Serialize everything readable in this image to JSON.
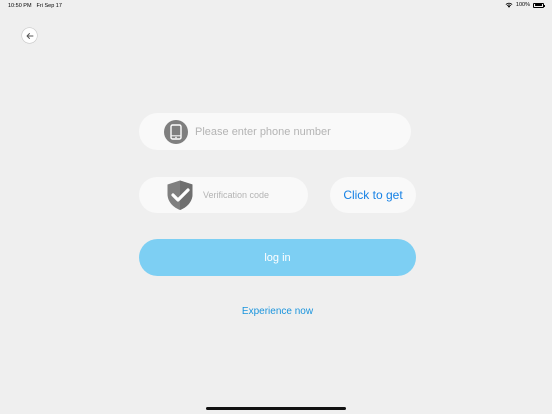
{
  "status_bar": {
    "time": "10:50 PM",
    "date": "Fri Sep 17",
    "battery_percent": "100%",
    "wifi_icon": "wifi-icon",
    "battery_icon": "battery-icon"
  },
  "nav": {
    "back_icon": "arrow-left-icon"
  },
  "login_form": {
    "phone": {
      "icon": "smartphone-icon",
      "value": "",
      "placeholder": "Please enter phone number"
    },
    "verification": {
      "icon": "shield-check-icon",
      "value": "",
      "placeholder": "Verification code"
    },
    "get_code_label": "Click to get",
    "login_label": "log in",
    "experience_label": "Experience now"
  },
  "colors": {
    "background": "#efefef",
    "field_background": "#f9f9f9",
    "login_button": "#7dcff3",
    "accent_blue": "#1581e5",
    "link_blue": "#1a94dd",
    "icon_gray": "#7f7f7f",
    "placeholder": "#b4b4b4"
  }
}
